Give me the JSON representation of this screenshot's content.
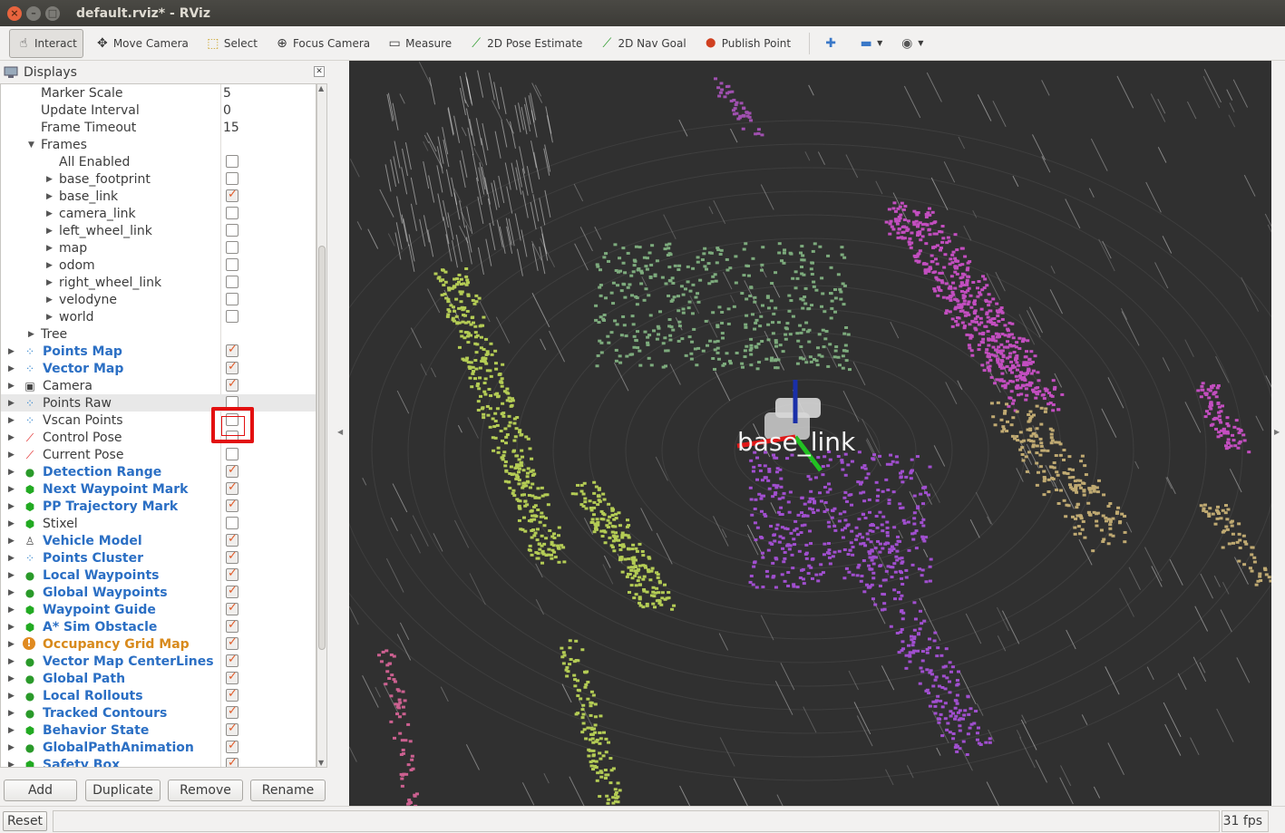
{
  "window": {
    "title": "default.rviz* - RViz"
  },
  "toolbar": [
    {
      "label": "Interact",
      "icon": "hand-icon",
      "active": true
    },
    {
      "label": "Move Camera",
      "icon": "move-icon"
    },
    {
      "label": "Select",
      "icon": "select-icon"
    },
    {
      "label": "Focus Camera",
      "icon": "focus-icon"
    },
    {
      "label": "Measure",
      "icon": "ruler-icon"
    },
    {
      "label": "2D Pose Estimate",
      "icon": "pose-arrow-icon"
    },
    {
      "label": "2D Nav Goal",
      "icon": "nav-arrow-icon"
    },
    {
      "label": "Publish Point",
      "icon": "pin-icon"
    }
  ],
  "displays": {
    "title": "Displays",
    "rows": [
      {
        "label": "Marker Scale",
        "value": "5",
        "indent": 44,
        "type": "prop"
      },
      {
        "label": "Update Interval",
        "value": "0",
        "indent": 44,
        "type": "prop"
      },
      {
        "label": "Frame Timeout",
        "value": "15",
        "indent": 44,
        "type": "prop"
      },
      {
        "label": "Frames",
        "indent": 44,
        "type": "group",
        "expanded": true
      },
      {
        "label": "All Enabled",
        "indent": 64,
        "type": "check",
        "checked": false
      },
      {
        "label": "base_footprint",
        "indent": 64,
        "type": "frame",
        "checked": false
      },
      {
        "label": "base_link",
        "indent": 64,
        "type": "frame",
        "checked": true
      },
      {
        "label": "camera_link",
        "indent": 64,
        "type": "frame",
        "checked": false
      },
      {
        "label": "left_wheel_link",
        "indent": 64,
        "type": "frame",
        "checked": false
      },
      {
        "label": "map",
        "indent": 64,
        "type": "frame",
        "checked": false
      },
      {
        "label": "odom",
        "indent": 64,
        "type": "frame",
        "checked": false
      },
      {
        "label": "right_wheel_link",
        "indent": 64,
        "type": "frame",
        "checked": false
      },
      {
        "label": "velodyne",
        "indent": 64,
        "type": "frame",
        "checked": false
      },
      {
        "label": "world",
        "indent": 64,
        "type": "frame",
        "checked": false
      },
      {
        "label": "Tree",
        "indent": 44,
        "type": "group",
        "expanded": false
      },
      {
        "label": "Points Map",
        "icon": "pointcloud-icon",
        "style": "blue",
        "checked": true
      },
      {
        "label": "Vector Map",
        "icon": "pointcloud-icon",
        "style": "blue",
        "checked": true
      },
      {
        "label": "Camera",
        "icon": "camera-icon",
        "style": "normal",
        "checked": true
      },
      {
        "label": "Points Raw",
        "icon": "pointcloud-icon",
        "style": "normal",
        "checked": false,
        "selected": true
      },
      {
        "label": "Vscan Points",
        "icon": "pointcloud-icon",
        "style": "normal",
        "checked": false
      },
      {
        "label": "Control Pose",
        "icon": "pose-icon",
        "style": "normal",
        "checked": false
      },
      {
        "label": "Current Pose",
        "icon": "pose-icon",
        "style": "normal",
        "checked": false
      },
      {
        "label": "Detection Range",
        "icon": "markerarray-icon",
        "style": "blue",
        "checked": true
      },
      {
        "label": "Next Waypoint Mark",
        "icon": "marker-icon",
        "style": "blue",
        "checked": true
      },
      {
        "label": "PP Trajectory Mark",
        "icon": "marker-icon",
        "style": "blue",
        "checked": true
      },
      {
        "label": "Stixel",
        "icon": "marker-icon",
        "style": "normal",
        "checked": false
      },
      {
        "label": "Vehicle Model",
        "icon": "robotmodel-icon",
        "style": "blue",
        "checked": true
      },
      {
        "label": "Points Cluster",
        "icon": "pointcloud-icon",
        "style": "blue",
        "checked": true
      },
      {
        "label": "Local Waypoints",
        "icon": "markerarray-icon",
        "style": "blue",
        "checked": true
      },
      {
        "label": "Global Waypoints",
        "icon": "markerarray-icon",
        "style": "blue",
        "checked": true
      },
      {
        "label": "Waypoint Guide",
        "icon": "marker-icon",
        "style": "blue",
        "checked": true
      },
      {
        "label": "A* Sim Obstacle",
        "icon": "marker-icon",
        "style": "blue",
        "checked": true
      },
      {
        "label": "Occupancy Grid Map",
        "icon": "warning-icon",
        "style": "orange",
        "checked": true
      },
      {
        "label": "Vector Map CenterLines",
        "icon": "markerarray-icon",
        "style": "blue",
        "checked": true
      },
      {
        "label": "Global Path",
        "icon": "markerarray-icon",
        "style": "blue",
        "checked": true
      },
      {
        "label": "Local Rollouts",
        "icon": "markerarray-icon",
        "style": "blue",
        "checked": true
      },
      {
        "label": "Tracked Contours",
        "icon": "markerarray-icon",
        "style": "blue",
        "checked": true
      },
      {
        "label": "Behavior State",
        "icon": "marker-icon",
        "style": "blue",
        "checked": true
      },
      {
        "label": "GlobalPathAnimation",
        "icon": "markerarray-icon",
        "style": "blue",
        "checked": true
      },
      {
        "label": "Safety Box",
        "icon": "marker-icon",
        "style": "blue",
        "checked": true
      }
    ]
  },
  "buttons": {
    "add": "Add",
    "duplicate": "Duplicate",
    "remove": "Remove",
    "rename": "Rename"
  },
  "viewport": {
    "frame_label": "base_link"
  },
  "status": {
    "reset": "Reset",
    "fps": "31 fps"
  },
  "colors": {
    "green_cloud": "#7dab7d",
    "lime_cloud": "#b4cc55",
    "magenta_cloud": "#c34ec0",
    "purple_cloud": "#a14fd0",
    "tan_cloud": "#c0aa72",
    "highlight": "#e31010"
  }
}
